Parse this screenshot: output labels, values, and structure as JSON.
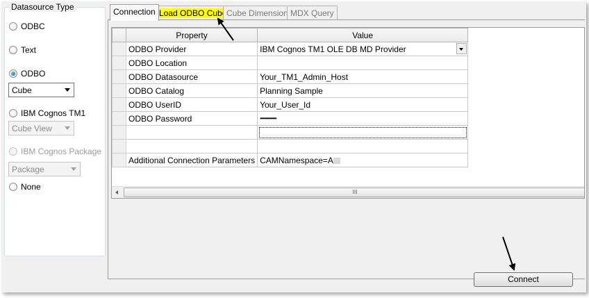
{
  "datasource": {
    "title": "Datasource Type",
    "options": [
      {
        "label": "ODBC",
        "checked": false,
        "enabled": true
      },
      {
        "label": "Text",
        "checked": false,
        "enabled": true
      },
      {
        "label": "ODBO",
        "checked": true,
        "enabled": true
      },
      {
        "label": "IBM Cognos TM1",
        "checked": false,
        "enabled": true
      },
      {
        "label": "IBM Cognos Package",
        "checked": false,
        "enabled": false
      },
      {
        "label": "None",
        "checked": false,
        "enabled": true
      }
    ],
    "odbo_combo": "Cube",
    "tm1_combo": "Cube View",
    "package_combo": "Package"
  },
  "tabs": [
    {
      "label": "Connection",
      "active": true
    },
    {
      "label": "Load ODBO Cube",
      "active": false,
      "highlight": "#ffff00"
    },
    {
      "label": "Cube Dimensions",
      "active": false
    },
    {
      "label": "MDX Query",
      "active": false
    }
  ],
  "grid": {
    "headers": {
      "property": "Property",
      "value": "Value"
    },
    "rows": [
      {
        "property": "ODBO Provider",
        "value": "IBM Cognos TM1 OLE DB MD Provider"
      },
      {
        "property": "ODBO Location",
        "value": ""
      },
      {
        "property": "ODBO Datasource",
        "value": "Your_TM1_Admin_Host"
      },
      {
        "property": "ODBO Catalog",
        "value": "Planning Sample"
      },
      {
        "property": "ODBO UserID",
        "value": "Your_User_Id"
      },
      {
        "property": "ODBO Password",
        "value": "•••••••••••••"
      },
      {
        "property": "",
        "value": ""
      },
      {
        "property": "",
        "value": ""
      },
      {
        "property": "Additional Connection Parameters",
        "value": "CAMNamespace=A"
      }
    ],
    "scroll_grip": "III"
  },
  "connect_label": "Connect",
  "colors": {
    "highlight": "#ffff00",
    "window": "#f0f0f0",
    "radio_accent": "#1b5fa8"
  }
}
